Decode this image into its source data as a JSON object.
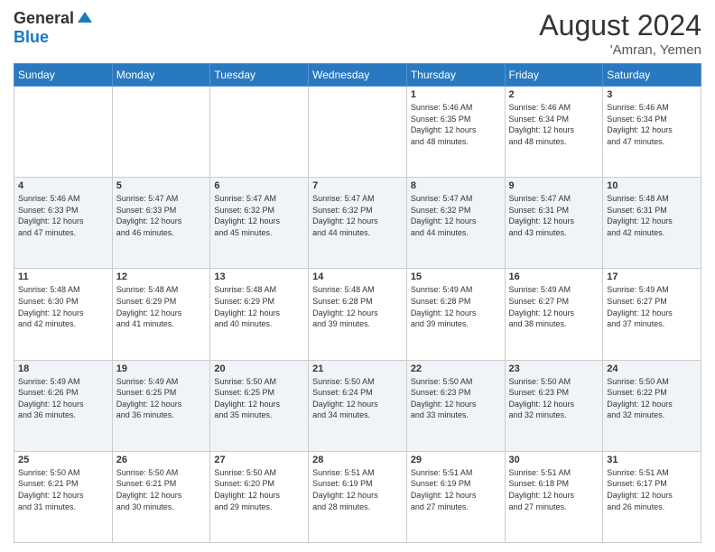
{
  "header": {
    "logo_general": "General",
    "logo_blue": "Blue",
    "month_title": "August 2024",
    "subtitle": "'Amran, Yemen"
  },
  "days_of_week": [
    "Sunday",
    "Monday",
    "Tuesday",
    "Wednesday",
    "Thursday",
    "Friday",
    "Saturday"
  ],
  "weeks": [
    [
      {
        "day": "",
        "text": ""
      },
      {
        "day": "",
        "text": ""
      },
      {
        "day": "",
        "text": ""
      },
      {
        "day": "",
        "text": ""
      },
      {
        "day": "1",
        "text": "Sunrise: 5:46 AM\nSunset: 6:35 PM\nDaylight: 12 hours\nand 48 minutes."
      },
      {
        "day": "2",
        "text": "Sunrise: 5:46 AM\nSunset: 6:34 PM\nDaylight: 12 hours\nand 48 minutes."
      },
      {
        "day": "3",
        "text": "Sunrise: 5:46 AM\nSunset: 6:34 PM\nDaylight: 12 hours\nand 47 minutes."
      }
    ],
    [
      {
        "day": "4",
        "text": "Sunrise: 5:46 AM\nSunset: 6:33 PM\nDaylight: 12 hours\nand 47 minutes."
      },
      {
        "day": "5",
        "text": "Sunrise: 5:47 AM\nSunset: 6:33 PM\nDaylight: 12 hours\nand 46 minutes."
      },
      {
        "day": "6",
        "text": "Sunrise: 5:47 AM\nSunset: 6:32 PM\nDaylight: 12 hours\nand 45 minutes."
      },
      {
        "day": "7",
        "text": "Sunrise: 5:47 AM\nSunset: 6:32 PM\nDaylight: 12 hours\nand 44 minutes."
      },
      {
        "day": "8",
        "text": "Sunrise: 5:47 AM\nSunset: 6:32 PM\nDaylight: 12 hours\nand 44 minutes."
      },
      {
        "day": "9",
        "text": "Sunrise: 5:47 AM\nSunset: 6:31 PM\nDaylight: 12 hours\nand 43 minutes."
      },
      {
        "day": "10",
        "text": "Sunrise: 5:48 AM\nSunset: 6:31 PM\nDaylight: 12 hours\nand 42 minutes."
      }
    ],
    [
      {
        "day": "11",
        "text": "Sunrise: 5:48 AM\nSunset: 6:30 PM\nDaylight: 12 hours\nand 42 minutes."
      },
      {
        "day": "12",
        "text": "Sunrise: 5:48 AM\nSunset: 6:29 PM\nDaylight: 12 hours\nand 41 minutes."
      },
      {
        "day": "13",
        "text": "Sunrise: 5:48 AM\nSunset: 6:29 PM\nDaylight: 12 hours\nand 40 minutes."
      },
      {
        "day": "14",
        "text": "Sunrise: 5:48 AM\nSunset: 6:28 PM\nDaylight: 12 hours\nand 39 minutes."
      },
      {
        "day": "15",
        "text": "Sunrise: 5:49 AM\nSunset: 6:28 PM\nDaylight: 12 hours\nand 39 minutes."
      },
      {
        "day": "16",
        "text": "Sunrise: 5:49 AM\nSunset: 6:27 PM\nDaylight: 12 hours\nand 38 minutes."
      },
      {
        "day": "17",
        "text": "Sunrise: 5:49 AM\nSunset: 6:27 PM\nDaylight: 12 hours\nand 37 minutes."
      }
    ],
    [
      {
        "day": "18",
        "text": "Sunrise: 5:49 AM\nSunset: 6:26 PM\nDaylight: 12 hours\nand 36 minutes."
      },
      {
        "day": "19",
        "text": "Sunrise: 5:49 AM\nSunset: 6:25 PM\nDaylight: 12 hours\nand 36 minutes."
      },
      {
        "day": "20",
        "text": "Sunrise: 5:50 AM\nSunset: 6:25 PM\nDaylight: 12 hours\nand 35 minutes."
      },
      {
        "day": "21",
        "text": "Sunrise: 5:50 AM\nSunset: 6:24 PM\nDaylight: 12 hours\nand 34 minutes."
      },
      {
        "day": "22",
        "text": "Sunrise: 5:50 AM\nSunset: 6:23 PM\nDaylight: 12 hours\nand 33 minutes."
      },
      {
        "day": "23",
        "text": "Sunrise: 5:50 AM\nSunset: 6:23 PM\nDaylight: 12 hours\nand 32 minutes."
      },
      {
        "day": "24",
        "text": "Sunrise: 5:50 AM\nSunset: 6:22 PM\nDaylight: 12 hours\nand 32 minutes."
      }
    ],
    [
      {
        "day": "25",
        "text": "Sunrise: 5:50 AM\nSunset: 6:21 PM\nDaylight: 12 hours\nand 31 minutes."
      },
      {
        "day": "26",
        "text": "Sunrise: 5:50 AM\nSunset: 6:21 PM\nDaylight: 12 hours\nand 30 minutes."
      },
      {
        "day": "27",
        "text": "Sunrise: 5:50 AM\nSunset: 6:20 PM\nDaylight: 12 hours\nand 29 minutes."
      },
      {
        "day": "28",
        "text": "Sunrise: 5:51 AM\nSunset: 6:19 PM\nDaylight: 12 hours\nand 28 minutes."
      },
      {
        "day": "29",
        "text": "Sunrise: 5:51 AM\nSunset: 6:19 PM\nDaylight: 12 hours\nand 27 minutes."
      },
      {
        "day": "30",
        "text": "Sunrise: 5:51 AM\nSunset: 6:18 PM\nDaylight: 12 hours\nand 27 minutes."
      },
      {
        "day": "31",
        "text": "Sunrise: 5:51 AM\nSunset: 6:17 PM\nDaylight: 12 hours\nand 26 minutes."
      }
    ]
  ]
}
